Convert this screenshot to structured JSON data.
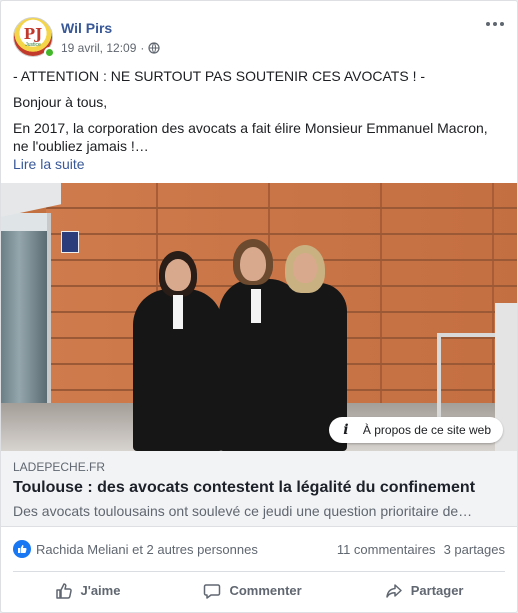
{
  "post": {
    "author": "Wil Pirs",
    "date": "19 avril, 12:09",
    "separator": "·",
    "avatar_mark": "PJ",
    "avatar_sub": "Justice",
    "text_lines": [
      "- ATTENTION : NE SURTOUT PAS SOUTENIR CES AVOCATS ! -",
      "Bonjour à tous,",
      "En 2017, la corporation des avocats a fait élire Monsieur Emmanuel Macron, ne l'oubliez jamais !…"
    ],
    "see_more": "Lire la suite"
  },
  "link_preview": {
    "domain": "LADEPECHE.FR",
    "title": "Toulouse : des avocats contestent la légalité du confinement",
    "description": "Des avocats toulousains ont soulevé ce jeudi une question prioritaire de…",
    "info_label": "À propos de ce site web"
  },
  "stats": {
    "reactions_label": "Rachida Meliani et 2 autres personnes",
    "comments": "11 commentaires",
    "shares": "3 partages"
  },
  "actions": {
    "like": "J'aime",
    "comment": "Commenter",
    "share": "Partager"
  },
  "colors": {
    "link_blue": "#385898",
    "like_blue": "#1877f2",
    "online_green": "#42b72a"
  },
  "icons": [
    "globe-icon",
    "more-icon",
    "info-icon",
    "like-icon",
    "comment-icon",
    "share-icon"
  ]
}
